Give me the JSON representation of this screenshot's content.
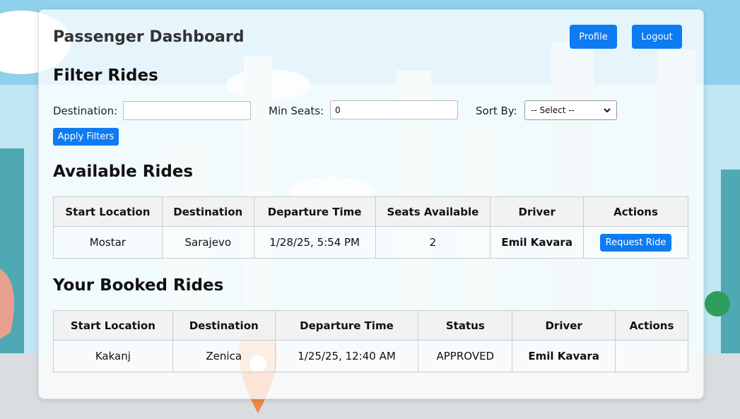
{
  "header": {
    "title": "Passenger Dashboard",
    "profile_label": "Profile",
    "logout_label": "Logout"
  },
  "filter": {
    "heading": "Filter Rides",
    "destination_label": "Destination:",
    "destination_value": "",
    "min_seats_label": "Min Seats:",
    "min_seats_value": "0",
    "sort_by_label": "Sort By:",
    "sort_by_selected": "-- Select --",
    "apply_label": "Apply Filters"
  },
  "available": {
    "heading": "Available Rides",
    "columns": [
      "Start Location",
      "Destination",
      "Departure Time",
      "Seats Available",
      "Driver",
      "Actions"
    ],
    "rows": [
      {
        "start": "Mostar",
        "destination": "Sarajevo",
        "departure": "1/28/25, 5:54 PM",
        "seats": "2",
        "driver": "Emil Kavara",
        "action": "Request Ride"
      }
    ]
  },
  "booked": {
    "heading": "Your Booked Rides",
    "columns": [
      "Start Location",
      "Destination",
      "Departure Time",
      "Status",
      "Driver",
      "Actions"
    ],
    "rows": [
      {
        "start": "Kakanj",
        "destination": "Zenica",
        "departure": "1/25/25, 12:40 AM",
        "status": "APPROVED",
        "driver": "Emil Kavara",
        "action": ""
      }
    ]
  },
  "colors": {
    "accent": "#0d7bf2",
    "sky": "#bfe6f2",
    "building": "#5fb3bd"
  }
}
